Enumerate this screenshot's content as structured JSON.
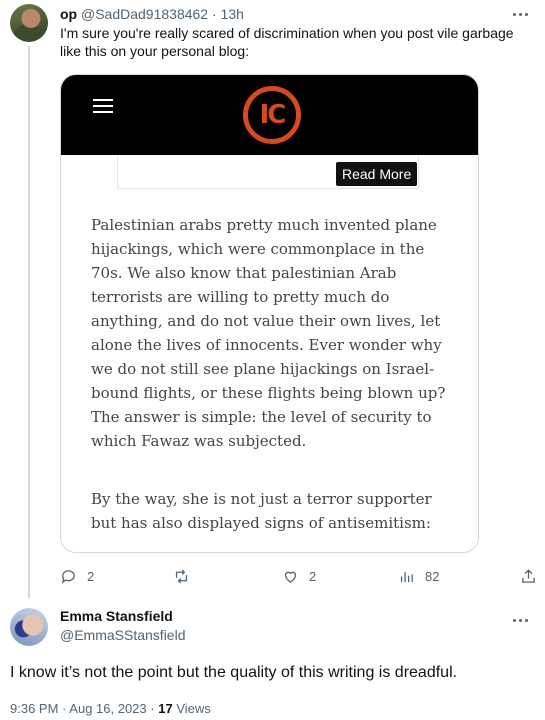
{
  "reply": {
    "name": "op",
    "handle": "@SadDad91838462",
    "separator": "·",
    "time": "13h",
    "text": "I'm sure you're really scared of discrimination when you post vile garbage like this on your personal blog:",
    "media": {
      "logo_text": "IC",
      "read_more_label": "Read More",
      "paragraphs": [
        "Palestinian arabs pretty much invented plane hijackings, which were commonplace in the 70s. We also know that palestinian Arab terrorists are willing to pretty much do anything, and do not value their own lives, let alone the lives of innocents. Ever wonder why we do not still see plane hijackings on Israel-bound flights, or these flights being blown up? The answer is simple: the level of security to which Fawaz was subjected.",
        "By the way, she is not just a terror supporter but has also displayed signs of antisemitism:"
      ]
    },
    "actions": {
      "replies": "2",
      "retweets": "",
      "likes": "2",
      "views": "82"
    }
  },
  "tweet": {
    "name": "Emma Stansfield",
    "handle": "@EmmaSStansfield",
    "text": "I know it’s not the point but the quality of this writing is dreadful.",
    "time": "9:36 PM",
    "date": "Aug 16, 2023",
    "views_count": "17",
    "views_label": "Views"
  },
  "colors": {
    "muted": "#536471",
    "border": "#cfd9de",
    "logo": "#d64a22"
  }
}
